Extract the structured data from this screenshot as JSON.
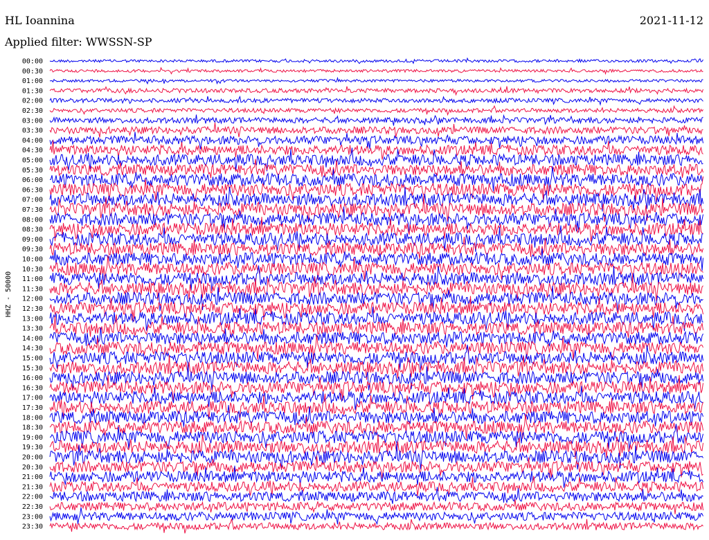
{
  "header": {
    "station": "HL Ioannina",
    "date": "2021-11-12",
    "filter": "Applied filter: WWSSN-SP"
  },
  "chart_data": {
    "type": "line",
    "title": "HL Ioannina",
    "subtitle": "Applied filter: WWSSN-SP",
    "ylabel": "HHZ - 50000",
    "xlabel": "",
    "row_labels": [
      "00:00",
      "00:30",
      "01:00",
      "01:30",
      "02:00",
      "02:30",
      "03:00",
      "03:30",
      "04:00",
      "04:30",
      "05:00",
      "05:30",
      "06:00",
      "06:30",
      "07:00",
      "07:30",
      "08:00",
      "08:30",
      "09:00",
      "09:30",
      "10:00",
      "10:30",
      "11:00",
      "11:30",
      "12:00",
      "12:30",
      "13:00",
      "13:30",
      "14:00",
      "14:30",
      "15:00",
      "15:30",
      "16:00",
      "16:30",
      "17:00",
      "17:30",
      "18:00",
      "18:30",
      "19:00",
      "19:30",
      "20:00",
      "20:30",
      "21:00",
      "21:30",
      "22:00",
      "22:30",
      "23:00",
      "23:30"
    ],
    "series_colors": [
      "#0000ee",
      "#ee1144"
    ],
    "noise_amplitude_by_row": [
      2,
      2,
      2,
      3,
      3,
      3,
      4,
      5,
      6,
      7,
      8,
      8,
      9,
      9,
      9,
      9,
      9,
      9,
      9,
      9,
      9,
      9,
      9,
      9,
      9,
      9,
      9,
      9,
      9,
      9,
      9,
      9,
      9,
      9,
      9,
      9,
      9,
      9,
      9,
      9,
      9,
      8,
      8,
      7,
      7,
      6,
      6,
      5
    ],
    "grid": false,
    "legend": "none"
  }
}
